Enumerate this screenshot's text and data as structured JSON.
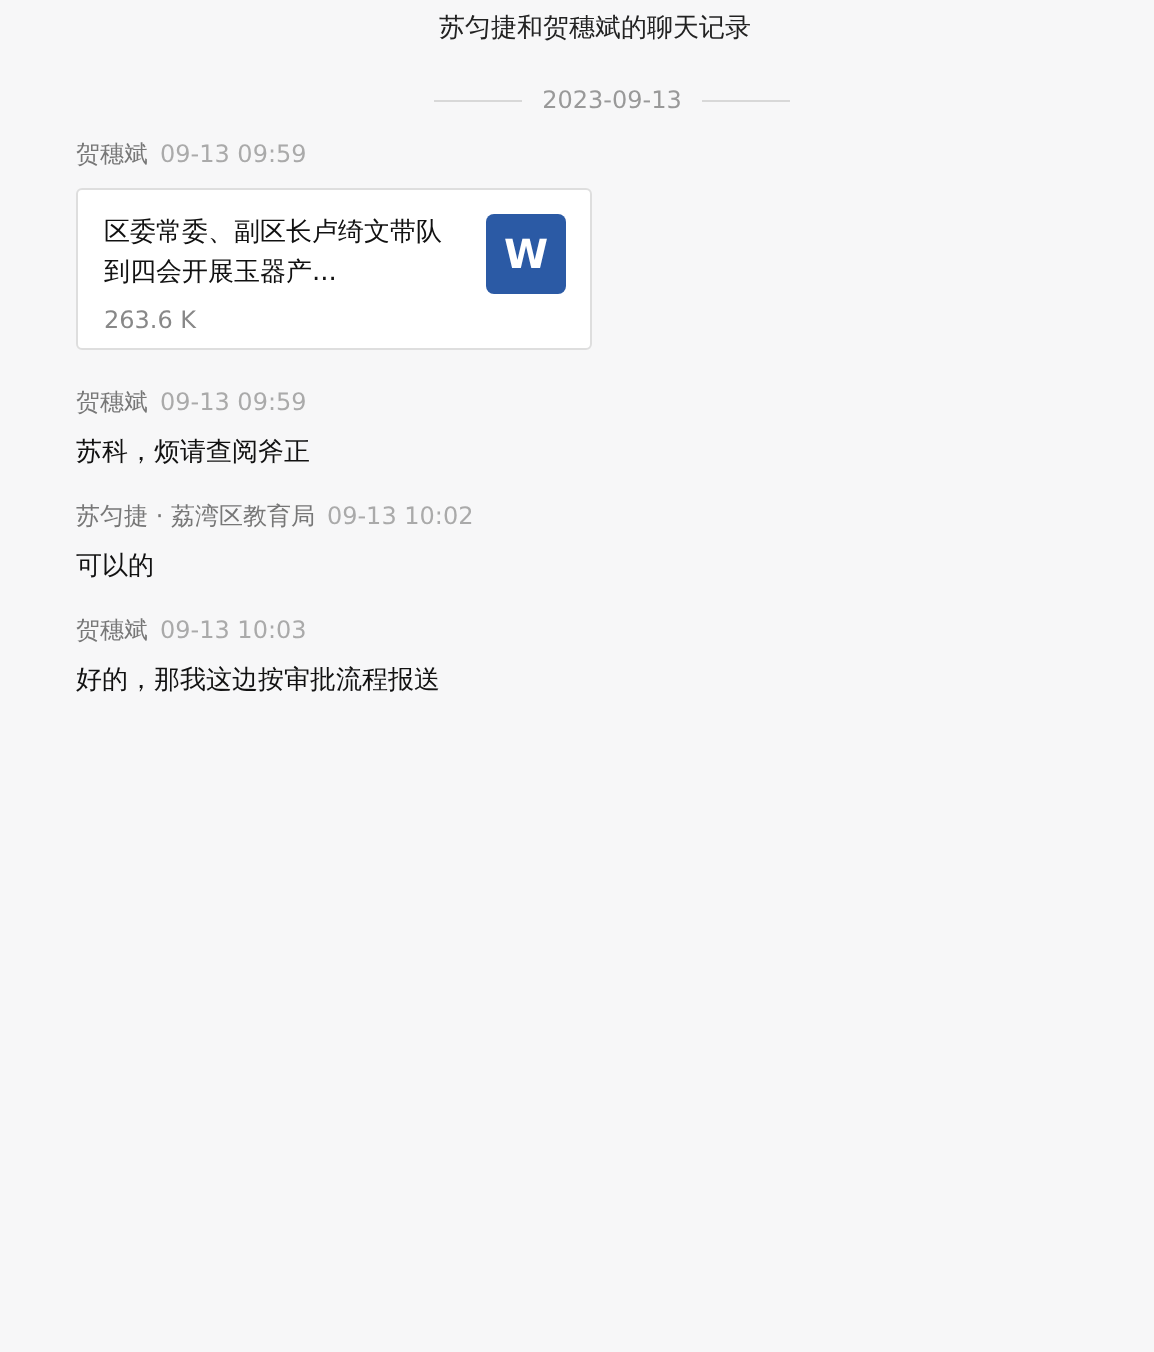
{
  "title": "苏匀捷和贺穗斌的聊天记录",
  "date_divider": "2023-09-13",
  "messages": [
    {
      "sender": "贺穗斌",
      "time": "09-13 09:59",
      "kind": "file",
      "file_name": "区委常委、副区长卢绮文带队到四会开展玉器产...",
      "file_size": "263.6 K",
      "file_icon": "W"
    },
    {
      "sender": "贺穗斌",
      "time": "09-13 09:59",
      "kind": "text",
      "text": "苏科，烦请查阅斧正"
    },
    {
      "sender": "苏匀捷 · 荔湾区教育局",
      "time": "09-13 10:02",
      "kind": "text",
      "text": "可以的"
    },
    {
      "sender": "贺穗斌",
      "time": "09-13 10:03",
      "kind": "text",
      "text": "好的，那我这边按审批流程报送"
    }
  ]
}
